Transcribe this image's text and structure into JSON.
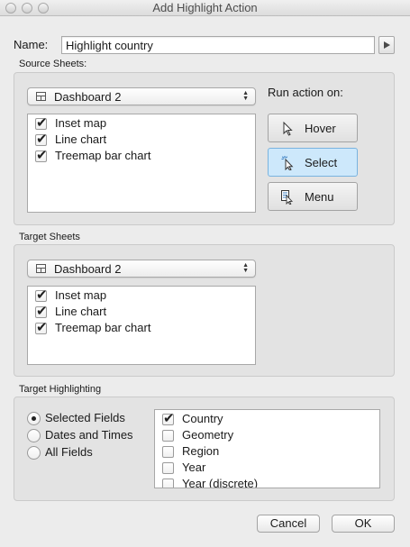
{
  "window": {
    "title": "Add Highlight Action"
  },
  "name_field": {
    "label": "Name:",
    "value": "Highlight country"
  },
  "source_sheets": {
    "label": "Source Sheets:",
    "dashboard": "Dashboard 2",
    "sheets": [
      {
        "label": "Inset map",
        "checked": true
      },
      {
        "label": "Line chart",
        "checked": true
      },
      {
        "label": "Treemap bar chart",
        "checked": true
      }
    ]
  },
  "run_action": {
    "label": "Run action on:",
    "options": [
      {
        "label": "Hover",
        "icon": "pointer-icon",
        "selected": false
      },
      {
        "label": "Select",
        "icon": "select-click-icon",
        "selected": true
      },
      {
        "label": "Menu",
        "icon": "menu-icon",
        "selected": false
      }
    ]
  },
  "target_sheets": {
    "label": "Target Sheets",
    "dashboard": "Dashboard 2",
    "sheets": [
      {
        "label": "Inset map",
        "checked": true
      },
      {
        "label": "Line chart",
        "checked": true
      },
      {
        "label": "Treemap bar chart",
        "checked": true
      }
    ]
  },
  "target_highlighting": {
    "label": "Target Highlighting",
    "radios": [
      {
        "label": "Selected Fields",
        "selected": true
      },
      {
        "label": "Dates and Times",
        "selected": false
      },
      {
        "label": "All Fields",
        "selected": false
      }
    ],
    "fields": [
      {
        "label": "Country",
        "checked": true
      },
      {
        "label": "Geometry",
        "checked": false
      },
      {
        "label": "Region",
        "checked": false
      },
      {
        "label": "Year",
        "checked": false
      },
      {
        "label": "Year (discrete)",
        "checked": false
      }
    ]
  },
  "buttons": {
    "cancel": "Cancel",
    "ok": "OK"
  },
  "glyphs": {
    "tick": "✔",
    "stepper_up": "▲",
    "stepper_down": "▼"
  },
  "colors": {
    "selected_button_bg": "#cde8fb",
    "selected_button_border": "#79b3df",
    "group_bg": "#e3e3e3"
  }
}
